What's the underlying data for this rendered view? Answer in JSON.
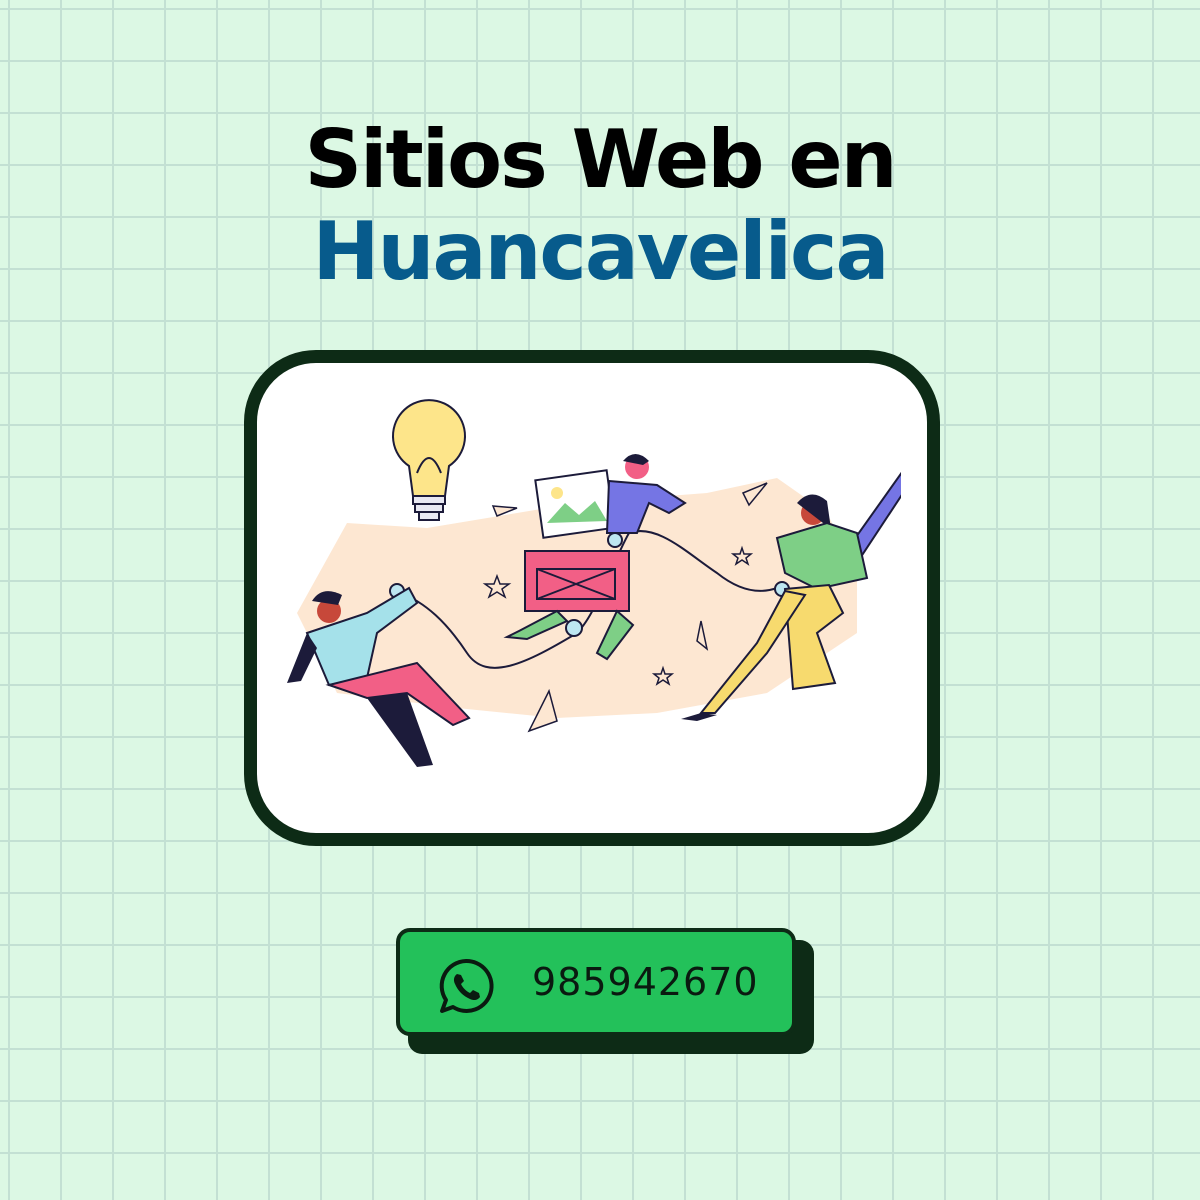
{
  "heading": {
    "line1": "Sitios Web en",
    "line2": "Huancavelica"
  },
  "colors": {
    "background": "#dcf8e4",
    "heading_primary": "#000000",
    "heading_accent": "#075b8c",
    "card_border": "#0d2b16",
    "button": "#23c15a"
  },
  "contact": {
    "icon": "whatsapp-icon",
    "phone": "985942670"
  }
}
